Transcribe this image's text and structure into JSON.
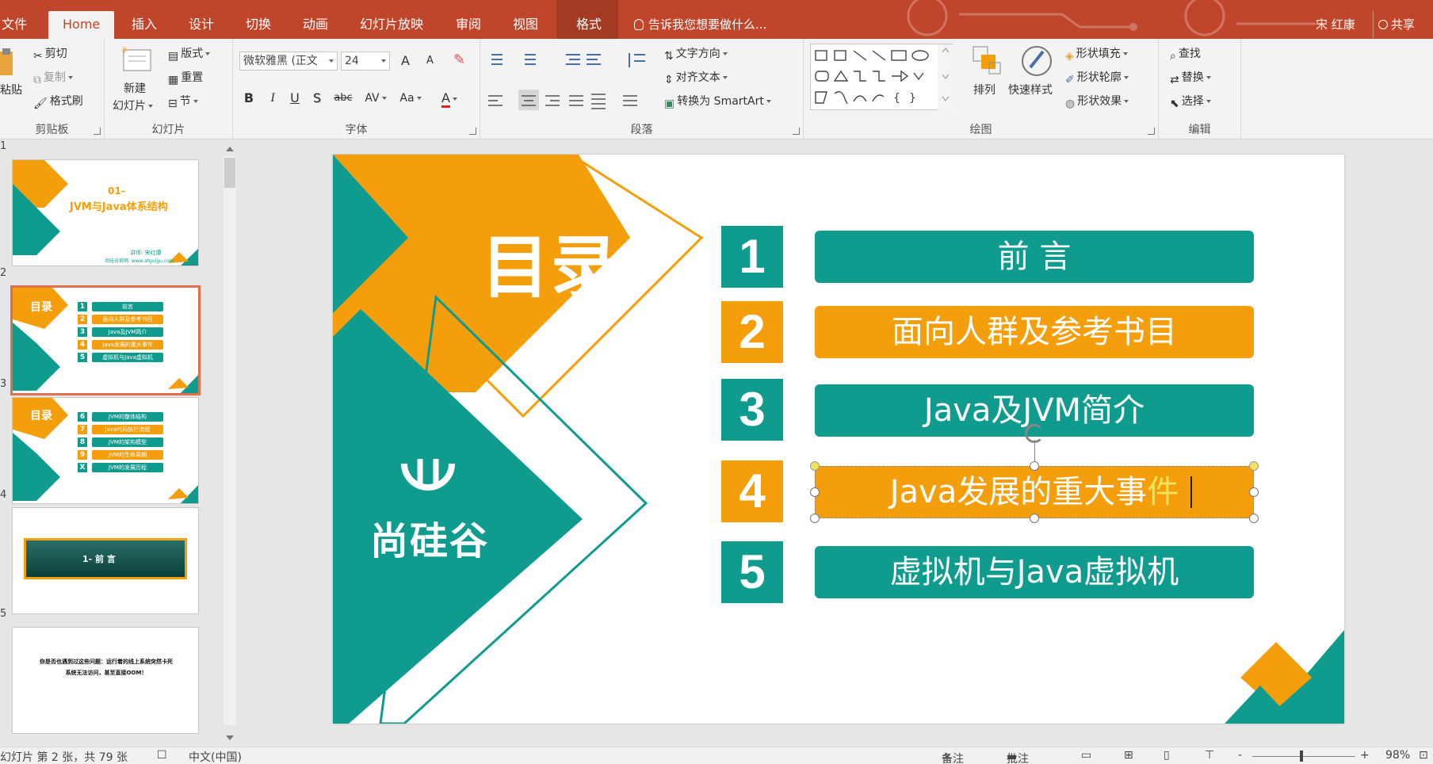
{
  "tabs": {
    "file": "文件",
    "home": "Home",
    "insert": "插入",
    "design": "设计",
    "transitions": "切换",
    "animations": "动画",
    "slideshow": "幻灯片放映",
    "review": "审阅",
    "view": "视图",
    "format": "格式",
    "tell_me": "告诉我您想要做什么...",
    "user": "宋 红康",
    "share": "共享"
  },
  "ribbon": {
    "clipboard": {
      "paste": "粘贴",
      "cut": "剪切",
      "copy": "复制",
      "format_painter": "格式刷",
      "label": "剪贴板"
    },
    "slides": {
      "new_slide_line1": "新建",
      "new_slide_line2": "幻灯片",
      "layout": "版式",
      "reset": "重置",
      "section": "节",
      "label": "幻灯片"
    },
    "font": {
      "font_name": "微软雅黑 (正文",
      "font_size": "24",
      "grow": "A",
      "shrink": "A",
      "bold": "B",
      "italic": "I",
      "underline": "U",
      "shadow": "S",
      "strike": "abc",
      "spacing": "AV",
      "case": "Aa",
      "color": "A",
      "label": "字体"
    },
    "paragraph": {
      "text_direction": "文字方向",
      "align_text": "对齐文本",
      "smartart": "转换为 SmartArt",
      "label": "段落"
    },
    "drawing": {
      "arrange": "排列",
      "quick_styles": "快速样式",
      "shape_fill": "形状填充",
      "shape_outline": "形状轮廓",
      "shape_effects": "形状效果",
      "label": "绘图"
    },
    "editing": {
      "find": "查找",
      "replace": "替换",
      "select": "选择",
      "label": "编辑"
    }
  },
  "thumbnails": [
    {
      "num": "1",
      "line1": "01-",
      "line2": "JVM与Java体系结构",
      "footer1": "讲师: 宋红康",
      "footer2": "尚硅谷官网: www.atguigu.com"
    },
    {
      "num": "2",
      "title": "目录",
      "items": [
        "前言",
        "面向人群及参考书目",
        "Java及JVM简介",
        "Java发展的重大事件",
        "虚拟机与Java虚拟机"
      ],
      "nums": [
        "1",
        "2",
        "3",
        "4",
        "5"
      ]
    },
    {
      "num": "3",
      "title": "目录",
      "items": [
        "JVM的整体结构",
        "Java代码执行流程",
        "JVM的架构模型",
        "JVM的生命周期",
        "JVM的发展历程"
      ],
      "nums": [
        "6",
        "7",
        "8",
        "9",
        "X"
      ]
    },
    {
      "num": "4",
      "line1": "1- 前 言"
    },
    {
      "num": "5",
      "line1": "你是否也遇到过这些问题：运行着的线上系统突然卡死",
      "line2": "系统无法访问，甚至直接OOM！"
    }
  ],
  "slide": {
    "title": "目录",
    "logo": "尚硅谷",
    "rows": [
      {
        "num": "1",
        "text": "前 言",
        "color": "teal"
      },
      {
        "num": "2",
        "text": "面向人群及参考书目",
        "color": "orange"
      },
      {
        "num": "3",
        "text": "Java及JVM简介",
        "color": "teal"
      },
      {
        "num": "4",
        "text": "Java发展的重大事",
        "highlight": "件",
        "color": "orange"
      },
      {
        "num": "5",
        "text": "虚拟机与Java虚拟机",
        "color": "teal"
      }
    ]
  },
  "status": {
    "slide_info": "幻灯片 第 2 张，共 79 张",
    "language": "中文(中国)",
    "notes": "备注",
    "comments": "批注",
    "zoom_minus": "-",
    "zoom_plus": "+",
    "zoom": "98%"
  },
  "colors": {
    "ribbon_red": "#c0462b",
    "teal": "#0f9b8e",
    "orange": "#f59e0b"
  }
}
